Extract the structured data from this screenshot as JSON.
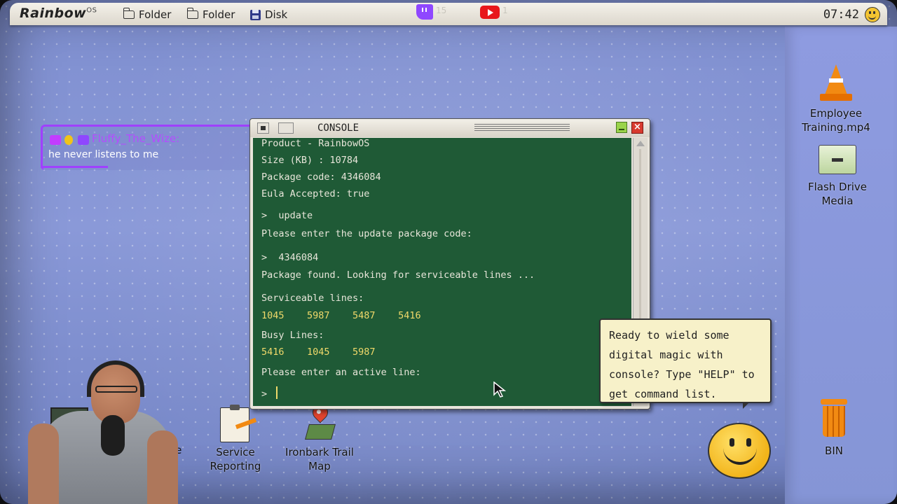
{
  "menubar": {
    "logo": "Rainbow",
    "logo_sup": "OS",
    "items": [
      {
        "label": "Folder",
        "icon": "folder-icon"
      },
      {
        "label": "Folder",
        "icon": "folder-icon"
      },
      {
        "label": "Disk",
        "icon": "disk-icon"
      }
    ],
    "twitch_count": "15",
    "youtube_count": "1",
    "clock": "07:42"
  },
  "chat": {
    "username": "Fluffy_The_Wize:",
    "message": "he never listens to me",
    "accent": "#a040ff"
  },
  "console": {
    "title": "CONSOLE",
    "lines": [
      {
        "text": "Product - RainbowOS",
        "color": "white"
      },
      {
        "text": "Size (KB) : 10784",
        "color": "white"
      },
      {
        "text": "Package code: 4346084",
        "color": "white"
      },
      {
        "text": "Eula Accepted: true",
        "color": "white"
      },
      {
        "text": ">  update",
        "color": "white"
      },
      {
        "text": "Please enter the update package code:",
        "color": "white"
      },
      {
        "text": ">  4346084",
        "color": "white"
      },
      {
        "text": "Package found. Looking for serviceable lines ...",
        "color": "white"
      },
      {
        "text": "Serviceable lines:",
        "color": "white"
      },
      {
        "text": "1045    5987    5487    5416",
        "color": "yellow"
      },
      {
        "text": "Busy Lines:",
        "color": "white"
      },
      {
        "text": "5416    1045    5987",
        "color": "yellow"
      },
      {
        "text": "Please enter an active line:",
        "color": "white"
      },
      {
        "text": ">",
        "color": "white"
      }
    ],
    "bg_color": "#1f5a36",
    "text_color": "#e8e6da",
    "highlight_color": "#f0d96a"
  },
  "tooltip": {
    "text": "Ready to wield some digital magic with console? Type \"HELP\" to get command list."
  },
  "desktop_icons": [
    {
      "label": "Employee Training.mp4",
      "icon": "traffic-cone-icon"
    },
    {
      "label": "Flash Drive Media",
      "icon": "folder-icon"
    },
    {
      "label": "BIN",
      "icon": "trash-bin-icon"
    },
    {
      "label": "Service Reporting",
      "icon": "clipboard-icon"
    },
    {
      "label": "Ironbark Trail Map",
      "icon": "map-pin-icon"
    },
    {
      "label": ".exe",
      "icon": "exe-icon"
    }
  ]
}
